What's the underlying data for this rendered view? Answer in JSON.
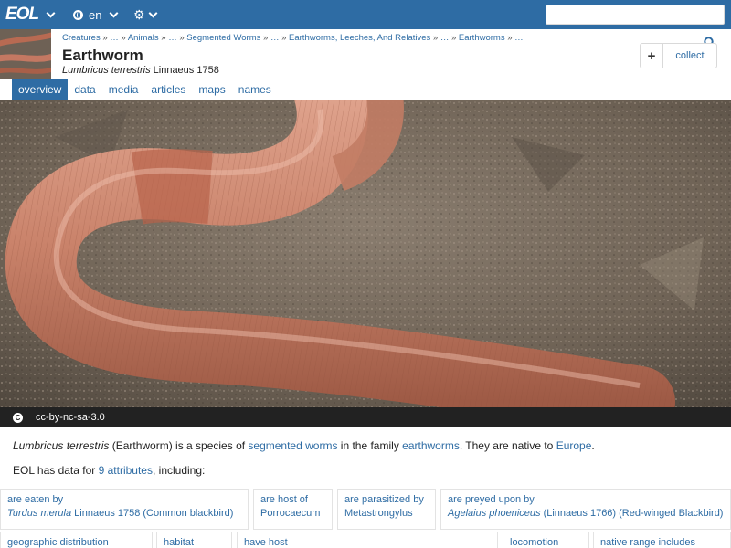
{
  "nav": {
    "logo": "EOL",
    "language": "en",
    "search_value": "",
    "search_placeholder": ""
  },
  "header": {
    "breadcrumb": [
      "Creatures",
      "…",
      "Animals",
      "…",
      "Segmented Worms",
      "…",
      "Earthworms, Leeches, And Relatives",
      "…",
      "Earthworms",
      "…"
    ],
    "title": "Earthworm",
    "scientific_name": "Lumbricus terrestris",
    "authority": "Linnaeus 1758",
    "collect_label": "collect",
    "collect_plus": "+"
  },
  "tabs": [
    "overview",
    "data",
    "media",
    "articles",
    "maps",
    "names"
  ],
  "active_tab": "overview",
  "image": {
    "license": "cc-by-nc-sa-3.0",
    "cc_symbol": "C"
  },
  "summary": {
    "sci_name": "Lumbricus terrestris",
    "part1": " (Earthworm) is a species of ",
    "link1": "segmented worms",
    "part2": " in the family ",
    "link2": "earthworms",
    "part3": ". They are native to ",
    "link3": "Europe",
    "part4": "."
  },
  "data_count": {
    "prefix": "EOL has data for ",
    "link": "9 attributes",
    "suffix": ", including:"
  },
  "attributes": [
    {
      "predicate": "are eaten by",
      "value_sci": "Turdus merula",
      "value_rest": " Linnaeus 1758 (Common blackbird)"
    },
    {
      "predicate": "are host of",
      "value_sci": "",
      "value_rest": "Porrocaecum"
    },
    {
      "predicate": "are parasitized by",
      "value_sci": "",
      "value_rest": "Metastrongylus"
    },
    {
      "predicate": "are preyed upon by",
      "value_sci": "Agelaius phoeniceus",
      "value_rest": " (Linnaeus 1766) (Red-winged Blackbird)"
    },
    {
      "predicate": "geographic distribution",
      "value_sci": "",
      "value_rest": ""
    },
    {
      "predicate": "habitat",
      "value_sci": "",
      "value_rest": ""
    },
    {
      "predicate": "have host",
      "value_sci": "",
      "value_rest": ""
    },
    {
      "predicate": "locomotion",
      "value_sci": "",
      "value_rest": ""
    },
    {
      "predicate": "native range includes",
      "value_sci": "",
      "value_rest": ""
    }
  ],
  "colors": {
    "brand": "#2e6ca4",
    "caption_bar": "#222222",
    "link": "#2e6ca4"
  },
  "icons": [
    "logo-chevron-icon",
    "globe-icon",
    "gear-icon",
    "search-icon",
    "plus-icon",
    "creative-commons-icon"
  ]
}
